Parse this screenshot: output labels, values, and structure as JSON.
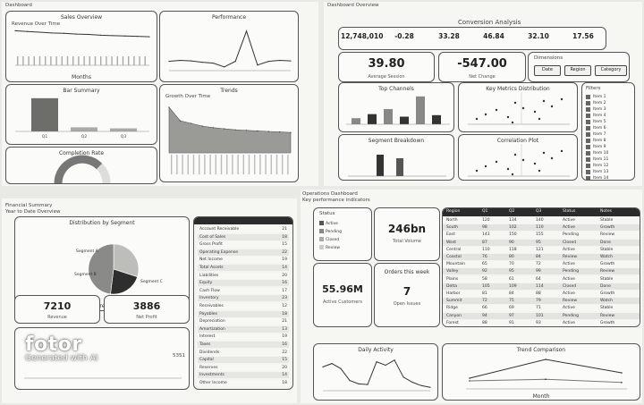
{
  "q1": {
    "header": "Dashboard",
    "line_card": {
      "title": "Sales Overview",
      "subtitle": "Revenue Over Time",
      "xlabel": "Months"
    },
    "spike_card": {
      "title": "Performance"
    },
    "bar_card": {
      "title": "Bar Summary",
      "ticks": [
        "Q1",
        "Q2",
        "Q3"
      ]
    },
    "area_card": {
      "title": "Trends",
      "subtitle": "Growth Over Time"
    },
    "gauge_card": {
      "title": "Completion Rate"
    }
  },
  "q2": {
    "header": "Dashboard Overview",
    "title": "Conversion Analysis",
    "stats": [
      {
        "value": "12,748,010",
        "label": ""
      },
      {
        "value": "-0.28",
        "label": ""
      },
      {
        "value": "33.28",
        "label": ""
      },
      {
        "value": "46.84",
        "label": ""
      },
      {
        "value": "32.10",
        "label": ""
      },
      {
        "value": "17.56",
        "label": ""
      }
    ],
    "big_kpis": [
      {
        "value": "39.80",
        "label": "Average Session"
      },
      {
        "value": "-547.00",
        "label": "Net Change"
      }
    ],
    "buttons_title": "Dimensions",
    "buttons": [
      "Date",
      "Region",
      "Category"
    ],
    "bar_card": {
      "title": "Top Channels"
    },
    "scatter_card": {
      "title": "Key Metrics Distribution"
    },
    "hbar_card": {
      "title": "Segment Breakdown"
    },
    "scatter2_card": {
      "title": "Correlation Plot"
    },
    "list_title": "Filters",
    "list_items": [
      "Item 1",
      "Item 2",
      "Item 3",
      "Item 4",
      "Item 5",
      "Item 6",
      "Item 7",
      "Item 8",
      "Item 9",
      "Item 10",
      "Item 11",
      "Item 12",
      "Item 13",
      "Item 14"
    ]
  },
  "q3": {
    "header": "Financial Summary",
    "subheader": "Year to Date Overview",
    "pie_card": {
      "title": "Distribution by Segment",
      "subtitle": "Revenue Share by Category"
    },
    "pie_labels": [
      "Segment A",
      "Segment B",
      "Segment C"
    ],
    "kpis": [
      {
        "value": "7210",
        "label": "Revenue"
      },
      {
        "value": "3886",
        "label": "Net Profit"
      }
    ],
    "table": {
      "header": "",
      "rows": [
        "Account Receivable",
        "Cost of Sales",
        "Gross Profit",
        "Operating Expense",
        "Net Income",
        "Total Assets",
        "Liabilities",
        "Equity",
        "Cash Flow",
        "Inventory",
        "Receivables",
        "Payables",
        "Depreciation",
        "Amortization",
        "Interest",
        "Taxes",
        "Dividends",
        "Capital",
        "Reserves",
        "Investments",
        "Other Income"
      ],
      "values": [
        "21",
        "18",
        "15",
        "22",
        "19",
        "14",
        "20",
        "16",
        "17",
        "23",
        "12",
        "18",
        "21",
        "13",
        "19",
        "16",
        "22",
        "15",
        "20",
        "14",
        "18"
      ]
    },
    "bottom_card": {
      "title": "",
      "value": "5351"
    }
  },
  "q4": {
    "header": "Operations Dashboard",
    "subheader": "Key performance indicators",
    "legend_title": "Status",
    "legend": [
      "Active",
      "Pending",
      "Closed",
      "Review"
    ],
    "kpis": [
      {
        "value": "246bn",
        "label": "Total Volume"
      },
      {
        "value": "55.96M",
        "label": "Active Customers"
      },
      {
        "value": "7",
        "label": "Open Issues"
      }
    ],
    "kpi_card_title": "Orders this week",
    "table_cols": [
      "Region",
      "Q1",
      "Q2",
      "Q3",
      "Status",
      "Notes"
    ],
    "table_rows": [
      [
        "North",
        "120",
        "134",
        "140",
        "Active",
        "Stable"
      ],
      [
        "South",
        "98",
        "102",
        "110",
        "Active",
        "Growth"
      ],
      [
        "East",
        "143",
        "150",
        "155",
        "Pending",
        "Review"
      ],
      [
        "West",
        "87",
        "90",
        "95",
        "Closed",
        "Done"
      ],
      [
        "Central",
        "110",
        "118",
        "121",
        "Active",
        "Stable"
      ],
      [
        "Coastal",
        "76",
        "80",
        "84",
        "Review",
        "Watch"
      ],
      [
        "Mountain",
        "65",
        "70",
        "72",
        "Active",
        "Growth"
      ],
      [
        "Valley",
        "92",
        "95",
        "99",
        "Pending",
        "Review"
      ],
      [
        "Plains",
        "58",
        "61",
        "64",
        "Active",
        "Stable"
      ],
      [
        "Delta",
        "105",
        "109",
        "114",
        "Closed",
        "Done"
      ],
      [
        "Harbor",
        "81",
        "84",
        "88",
        "Active",
        "Growth"
      ],
      [
        "Summit",
        "72",
        "75",
        "79",
        "Review",
        "Watch"
      ],
      [
        "Ridge",
        "66",
        "69",
        "71",
        "Active",
        "Stable"
      ],
      [
        "Canyon",
        "94",
        "97",
        "101",
        "Pending",
        "Review"
      ],
      [
        "Forest",
        "88",
        "91",
        "93",
        "Active",
        "Growth"
      ]
    ],
    "line_card": {
      "title": "Daily Activity"
    },
    "tri_card": {
      "title": "Trend Comparison",
      "xlabel": "Month"
    }
  },
  "watermark": {
    "brand": "fotor",
    "tagline": "Generated with AI"
  },
  "chart_data": [
    {
      "type": "line",
      "title": "Sales Overview",
      "values": [
        92,
        90,
        88,
        86,
        85,
        83,
        82,
        80,
        79,
        78,
        77,
        76
      ]
    },
    {
      "type": "line",
      "title": "Performance",
      "values": [
        20,
        22,
        21,
        18,
        16,
        8,
        20,
        85,
        12,
        20,
        22,
        21
      ]
    },
    {
      "type": "bar",
      "title": "Bar Summary",
      "categories": [
        "Q1",
        "Q2",
        "Q3"
      ],
      "values": [
        65,
        8,
        6
      ]
    },
    {
      "type": "area",
      "title": "Trends",
      "values": [
        85,
        60,
        55,
        50,
        47,
        45,
        43,
        42,
        41,
        40,
        39,
        38
      ]
    },
    {
      "type": "bar",
      "title": "Top Channels",
      "categories": [
        "A",
        "B",
        "C",
        "D",
        "E",
        "F"
      ],
      "values": [
        12,
        20,
        30,
        15,
        55,
        18
      ]
    },
    {
      "type": "pie",
      "title": "Distribution by Segment",
      "categories": [
        "Segment A",
        "Segment B",
        "Segment C"
      ],
      "values": [
        30,
        22,
        48
      ]
    },
    {
      "type": "line",
      "title": "Daily Activity",
      "values": [
        70,
        80,
        65,
        30,
        20,
        18,
        85,
        75,
        90,
        40,
        25,
        15,
        10
      ]
    },
    {
      "type": "line",
      "title": "Trend Comparison",
      "series": [
        {
          "values": [
            20,
            55,
            30
          ]
        },
        {
          "values": [
            15,
            18,
            12
          ]
        }
      ]
    }
  ]
}
